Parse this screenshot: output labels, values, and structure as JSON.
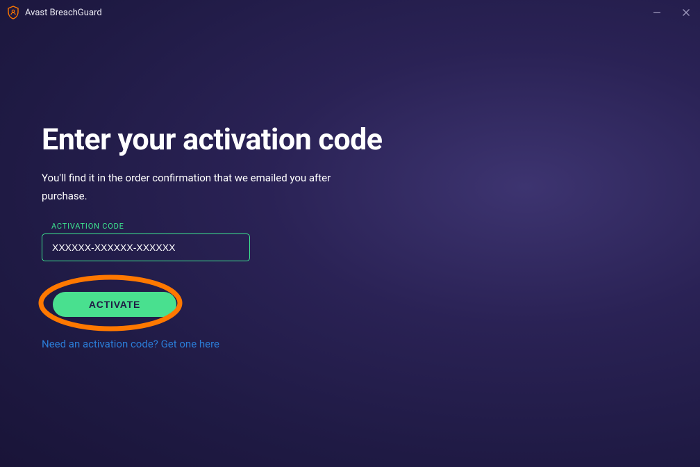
{
  "titlebar": {
    "app_name": "Avast BreachGuard"
  },
  "main": {
    "heading": "Enter your activation code",
    "subtext": "You'll find it in the order confirmation that we emailed you after purchase.",
    "field_label": "ACTIVATION CODE",
    "input_placeholder": "XXXXXX-XXXXXX-XXXXXX",
    "activate_label": "ACTIVATE",
    "need_code_link": "Need an activation code? Get one here"
  }
}
